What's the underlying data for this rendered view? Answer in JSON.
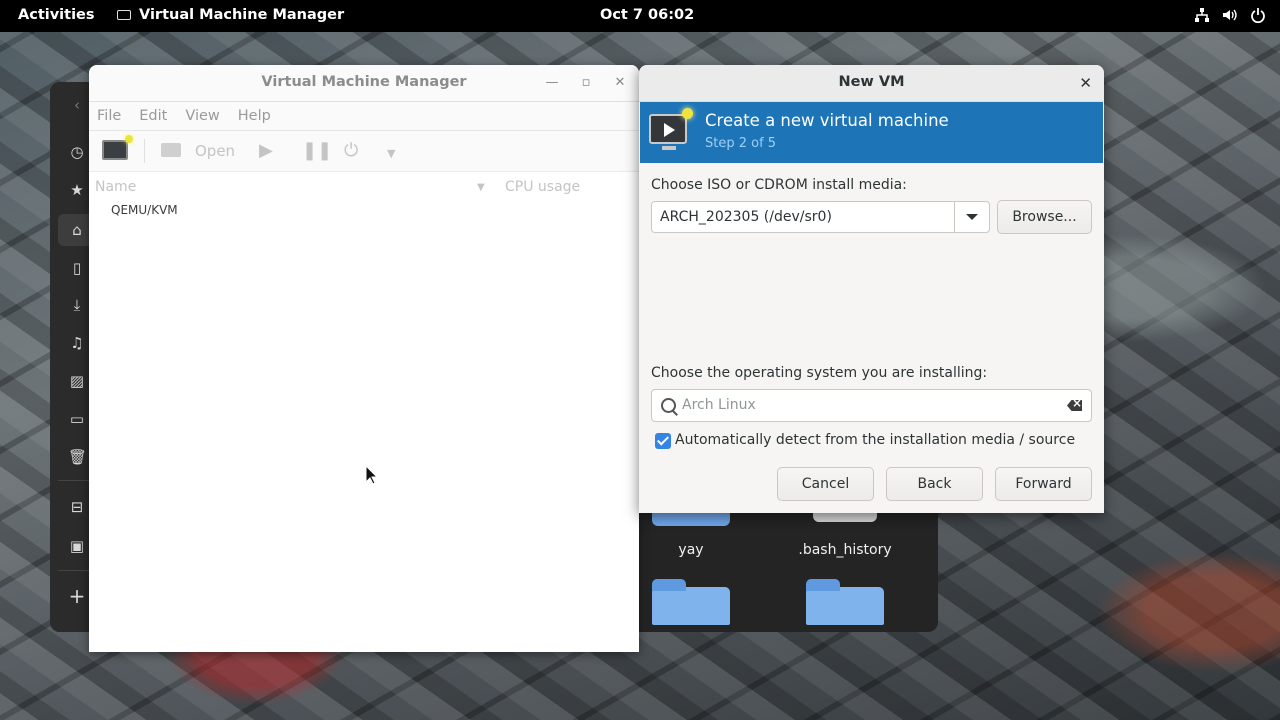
{
  "topbar": {
    "activities": "Activities",
    "app_name": "Virtual Machine Manager",
    "clock": "Oct 7  06:02"
  },
  "files_window": {
    "items": [
      {
        "label": "yay"
      },
      {
        "label": ".bash_history"
      }
    ]
  },
  "vmm": {
    "title": "Virtual Machine Manager",
    "menu": [
      "File",
      "Edit",
      "View",
      "Help"
    ],
    "toolbar": {
      "open_label": "Open"
    },
    "columns": {
      "name": "Name",
      "cpu": "CPU usage"
    },
    "connections": [
      "QEMU/KVM"
    ]
  },
  "newvm": {
    "title": "New VM",
    "banner_title": "Create a new virtual machine",
    "banner_step": "Step 2 of 5",
    "media_label": "Choose ISO or CDROM install media:",
    "media_value": "ARCH_202305 (/dev/sr0)",
    "browse_label": "Browse...",
    "os_label": "Choose the operating system you are installing:",
    "os_search_placeholder": "Arch Linux",
    "auto_detect_label": "Automatically detect from the installation media / source",
    "auto_detect_checked": true,
    "buttons": {
      "cancel": "Cancel",
      "back": "Back",
      "forward": "Forward"
    },
    "accent_color": "#1d74b7"
  },
  "icons": [
    "network-icon",
    "volume-icon",
    "power-icon",
    "play-icon",
    "pause-icon",
    "shutdown-icon",
    "dropdown-icon",
    "close-icon",
    "minimize-icon",
    "maximize-icon",
    "search-icon",
    "clear-icon"
  ]
}
